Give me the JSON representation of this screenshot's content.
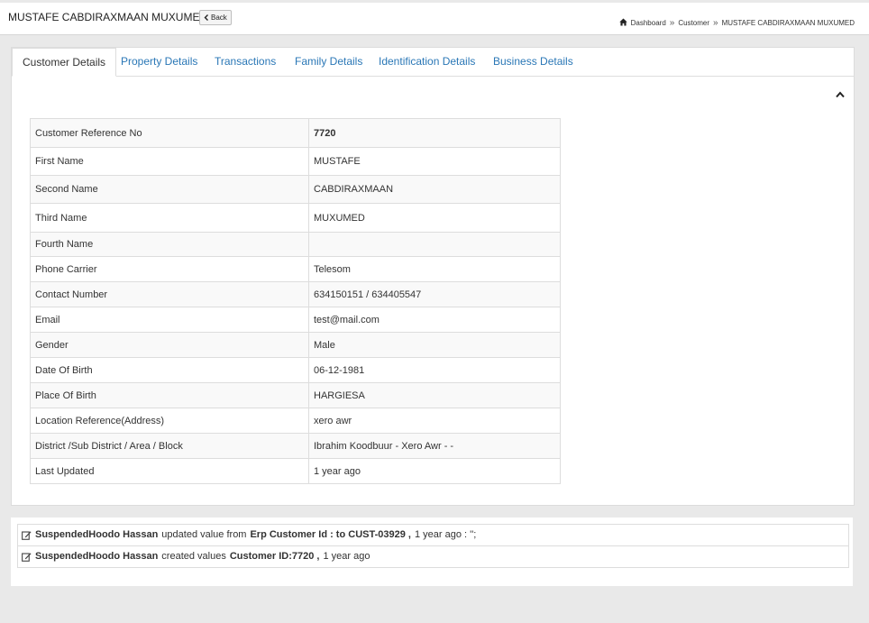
{
  "header": {
    "title": "MUSTAFE CABDIRAXMAAN MUXUMED",
    "back_label": "Back",
    "breadcrumb": [
      "Dashboard",
      "Customer",
      "MUSTAFE CABDIRAXMAAN MUXUMED"
    ]
  },
  "tabs": [
    {
      "label": "Customer Details",
      "active": true
    },
    {
      "label": "Property Details",
      "active": false
    },
    {
      "label": "Transactions",
      "active": false
    },
    {
      "label": "Family Details",
      "active": false
    },
    {
      "label": "Identification Details",
      "active": false
    },
    {
      "label": "Business Details",
      "active": false
    }
  ],
  "details": [
    {
      "label": "Customer Reference No",
      "value": "7720",
      "bold": true
    },
    {
      "label": "First Name",
      "value": "MUSTAFE"
    },
    {
      "label": "Second Name",
      "value": "CABDIRAXMAAN"
    },
    {
      "label": "Third Name",
      "value": "MUXUMED"
    },
    {
      "label": "Fourth Name",
      "value": ""
    },
    {
      "label": "Phone Carrier",
      "value": "Telesom"
    },
    {
      "label": "Contact Number",
      "value": "634150151 / 634405547"
    },
    {
      "label": "Email",
      "value": "test@mail.com"
    },
    {
      "label": "Gender",
      "value": "Male"
    },
    {
      "label": "Date Of Birth",
      "value": "06-12-1981"
    },
    {
      "label": "Place Of Birth",
      "value": "HARGIESA"
    },
    {
      "label": "Location Reference(Address)",
      "value": "xero awr"
    },
    {
      "label": "District /Sub District / Area / Block",
      "value": "Ibrahim Koodbuur - Xero Awr - -"
    },
    {
      "label": "Last Updated",
      "value": "1 year ago"
    }
  ],
  "activity_log": [
    {
      "user": "SuspendedHoodo Hassan",
      "action": "updated value from",
      "detail": "Erp Customer Id : to CUST-03929 ,",
      "time": "1 year ago : '';"
    },
    {
      "user": "SuspendedHoodo Hassan",
      "action": "created values",
      "detail": "Customer ID:7720 ,",
      "time": "1 year ago"
    }
  ],
  "colors": {
    "link": "#2a77b6",
    "background": "#e9e9e9"
  }
}
